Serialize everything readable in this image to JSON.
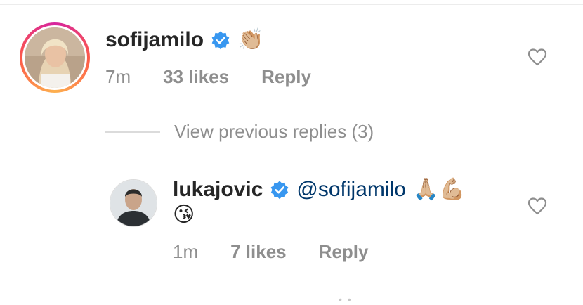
{
  "comments": [
    {
      "username": "sofijamilo",
      "text_emoji": "👏🏼",
      "time": "7m",
      "likes": "33 likes",
      "reply": "Reply",
      "verified_icon": "verified-badge-icon",
      "like_icon": "heart-outline-icon"
    },
    {
      "username": "lukajovic",
      "mention": "@sofijamilo",
      "text_emoji": "🙏🏼💪🏼",
      "second_line_emoji": "😘",
      "time": "1m",
      "likes": "7 likes",
      "reply": "Reply",
      "verified_icon": "verified-badge-icon",
      "like_icon": "heart-outline-icon"
    }
  ],
  "replies_toggle": {
    "label": "View previous replies (3)"
  },
  "colors": {
    "verified_blue": "#3897f0",
    "meta_gray": "#8e8e8e",
    "mention_blue": "#00376b"
  }
}
